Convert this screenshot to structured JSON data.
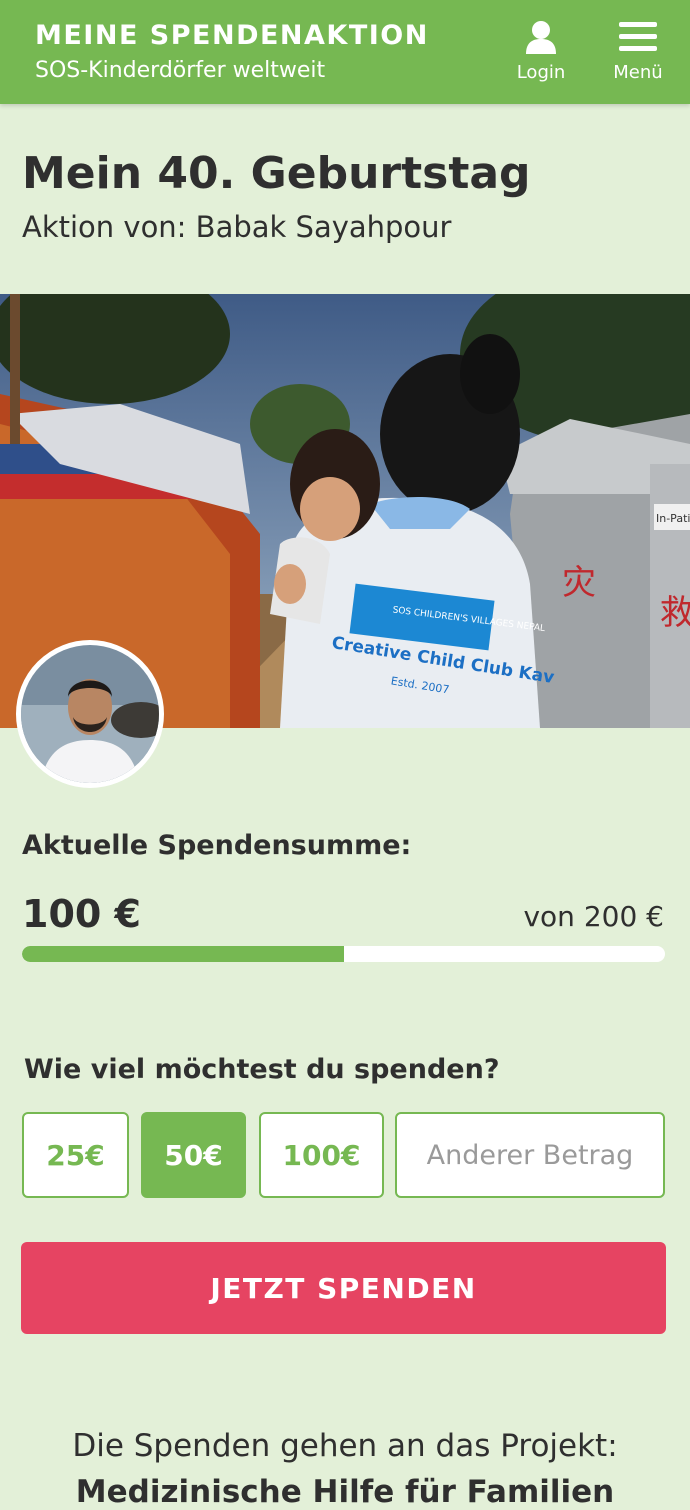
{
  "header": {
    "brand_title": "MEINE SPENDENAKTION",
    "brand_subtitle": "SOS-Kinderdörfer weltweit",
    "login_label": "Login",
    "menu_label": "Menü"
  },
  "campaign": {
    "title": "Mein 40. Geburtstag",
    "organizer": "Aktion von: Babak Sayahpour"
  },
  "hero_image": {
    "shirt_text_logo": "SOS CHILDREN'S VILLAGES NEPAL",
    "shirt_text_main": "Creative Child Club Kav",
    "shirt_text_est": "Estd. 2007",
    "tent_sign": "In-Patie"
  },
  "donation_status": {
    "label": "Aktuelle Spendensumme:",
    "amount": "100 €",
    "goal": "von 200 €",
    "progress_fraction": 0.5
  },
  "donation_form": {
    "question": "Wie viel möchtest du spenden?",
    "amounts": [
      "25€",
      "50€",
      "100€"
    ],
    "selected_amount": "50€",
    "other_placeholder": "Anderer Betrag",
    "submit_label": "JETZT SPENDEN"
  },
  "project": {
    "intro": "Die Spenden gehen an das Projekt:",
    "name": "Medizinische Hilfe für Familien"
  },
  "colors": {
    "brand_green": "#76b852",
    "background": "#e3f0d8",
    "cta_red": "#e64462"
  }
}
